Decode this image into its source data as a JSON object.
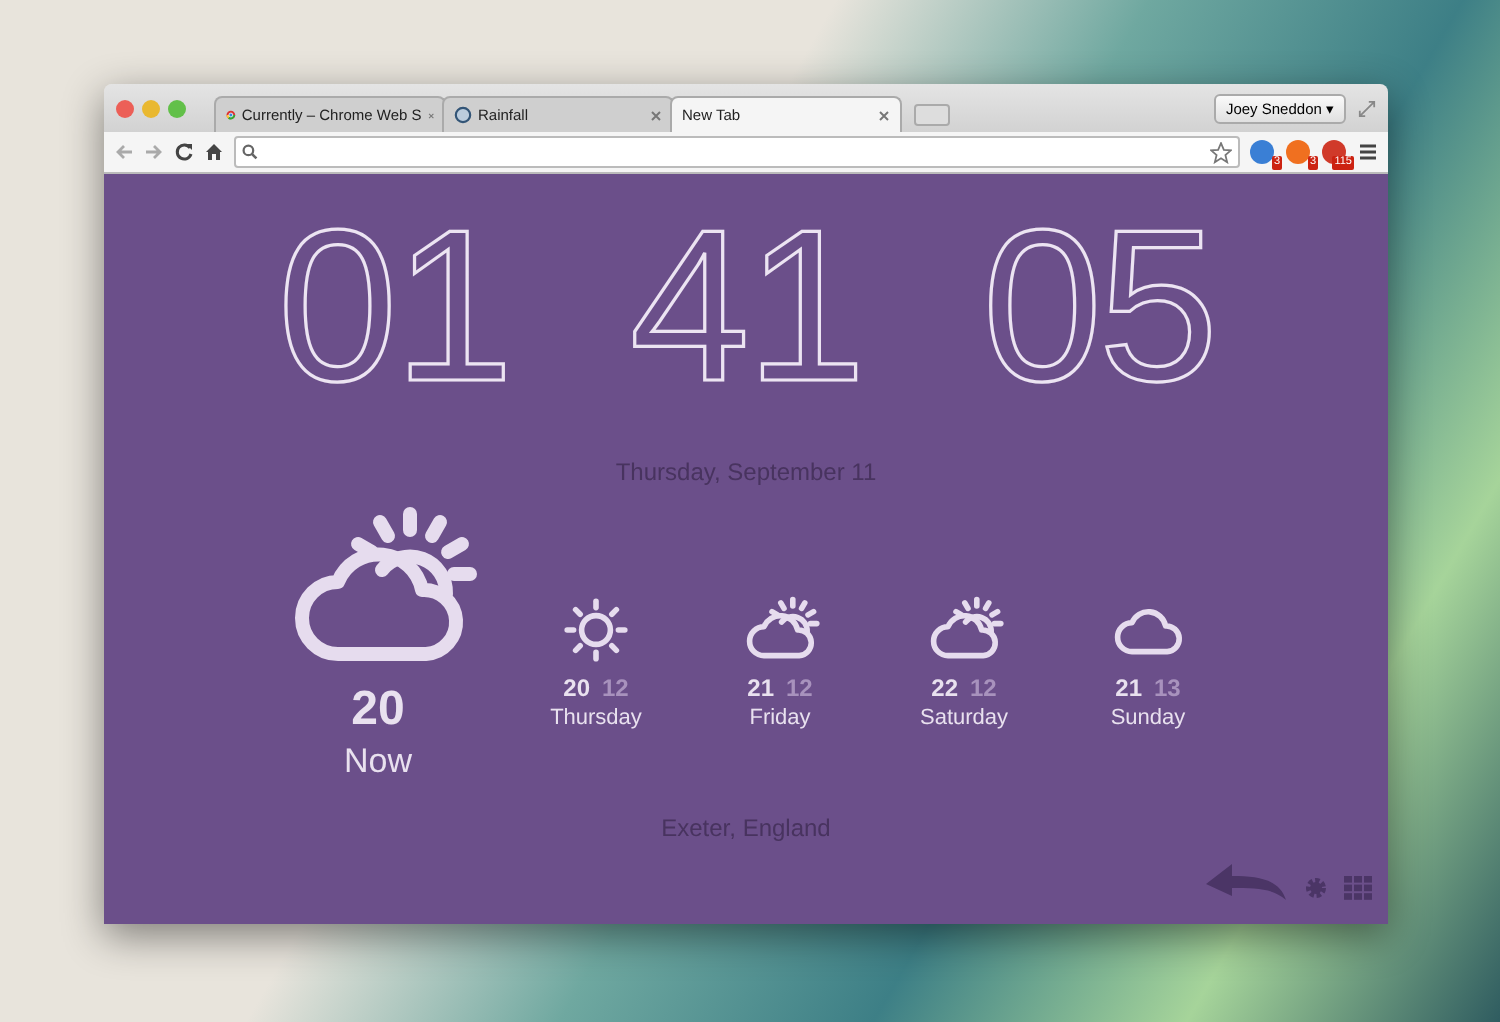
{
  "browser": {
    "tabs": [
      {
        "label": "Currently – Chrome Web S",
        "selected": false,
        "kind": "chrome"
      },
      {
        "label": "Rainfall",
        "selected": false,
        "kind": "globe"
      },
      {
        "label": "New Tab",
        "selected": true,
        "kind": "none"
      }
    ],
    "profile": "Joey Sneddon ▾",
    "extensions": [
      {
        "badge": "3",
        "color": "#3a7fd5"
      },
      {
        "badge": "3",
        "color": "#f07020"
      },
      {
        "badge": "115",
        "color": "#d03a2a"
      }
    ]
  },
  "clock": {
    "hours": "01",
    "minutes": "41",
    "seconds": "05"
  },
  "date": "Thursday, September 11",
  "now": {
    "kind": "partly-cloudy",
    "temp": "20",
    "label": "Now"
  },
  "forecast": [
    {
      "kind": "sunny",
      "high": "20",
      "low": "12",
      "day": "Thursday"
    },
    {
      "kind": "partly-cloudy",
      "high": "21",
      "low": "12",
      "day": "Friday"
    },
    {
      "kind": "partly-cloudy",
      "high": "22",
      "low": "12",
      "day": "Saturday"
    },
    {
      "kind": "cloudy",
      "high": "21",
      "low": "13",
      "day": "Sunday"
    }
  ],
  "location": "Exeter, England"
}
